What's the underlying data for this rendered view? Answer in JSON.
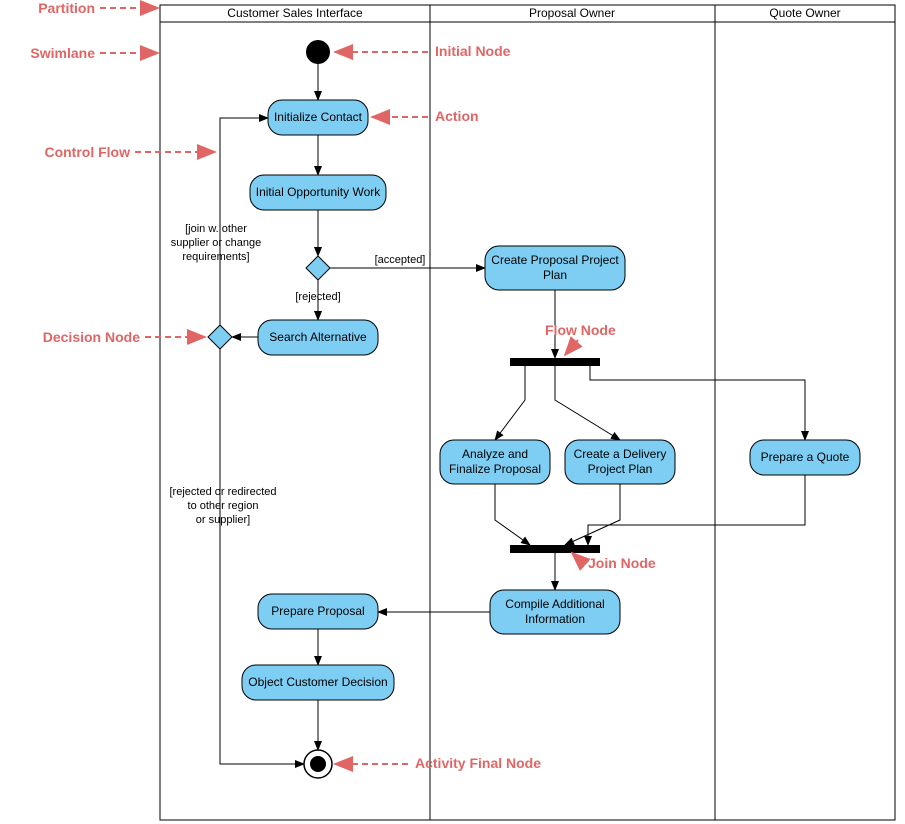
{
  "lanes": {
    "lane1": "Customer Sales Interface",
    "lane2": "Proposal Owner",
    "lane3": "Quote Owner"
  },
  "actions": {
    "initializeContact": "Initialize Contact",
    "initialOpportunity": "Initial Opportunity Work",
    "searchAlternative": "Search Alternative",
    "createProposalPlan": "Create Proposal Project Plan",
    "analyzeFinalize": "Analyze and Finalize Proposal",
    "createDelivery": "Create a Delivery Project Plan",
    "prepareQuote": "Prepare a Quote",
    "compileAdditional": "Compile Additional Information",
    "prepareProposal": "Prepare Proposal",
    "objectCustomerDecision": "Object Customer Decision"
  },
  "guards": {
    "accepted": "[accepted]",
    "rejected": "[rejected]",
    "joinOther1": "[join w. other",
    "joinOther2": "supplier or change",
    "joinOther3": "requirements]",
    "rejectedRedirect1": "[rejected or redirected",
    "rejectedRedirect2": "to other region",
    "rejectedRedirect3": "or supplier]"
  },
  "annotations": {
    "partition": "Partition",
    "swimlane": "Swimlane",
    "controlFlow": "Control Flow",
    "decisionNode": "Decision Node",
    "initialNode": "Initial Node",
    "action": "Action",
    "flowNode": "Flow Node",
    "joinNode": "Join Node",
    "activityFinalNode": "Activity Final Node"
  }
}
